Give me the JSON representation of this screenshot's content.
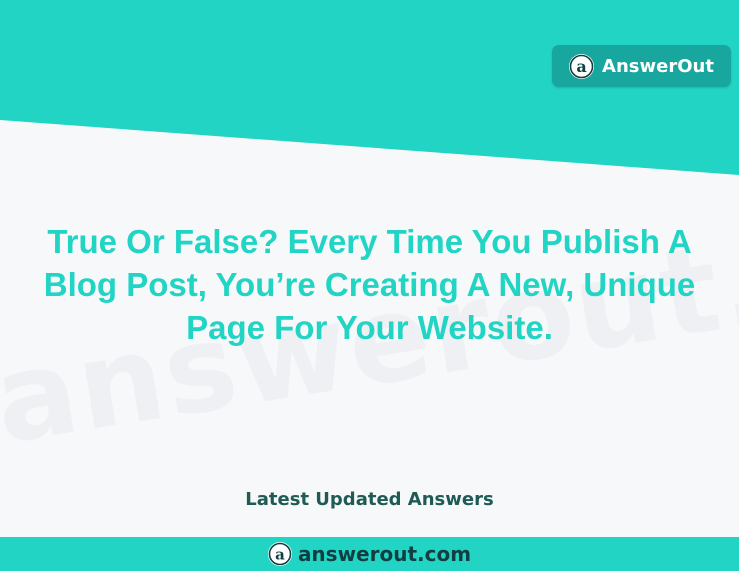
{
  "brand": {
    "name": "AnswerOut",
    "site": "answerout.com",
    "logo_letter": "a",
    "colors": {
      "teal": "#22d4c4",
      "dark_teal": "#18a79f",
      "text_dark": "#1f5a55"
    }
  },
  "watermark": "answerout.com",
  "question": {
    "lines": [
      "True Or False? Every Time You Publish A",
      "Blog Post, You’re Creating A New, Unique",
      "Page For Your Website."
    ]
  },
  "latest_label": "Latest Updated Answers"
}
